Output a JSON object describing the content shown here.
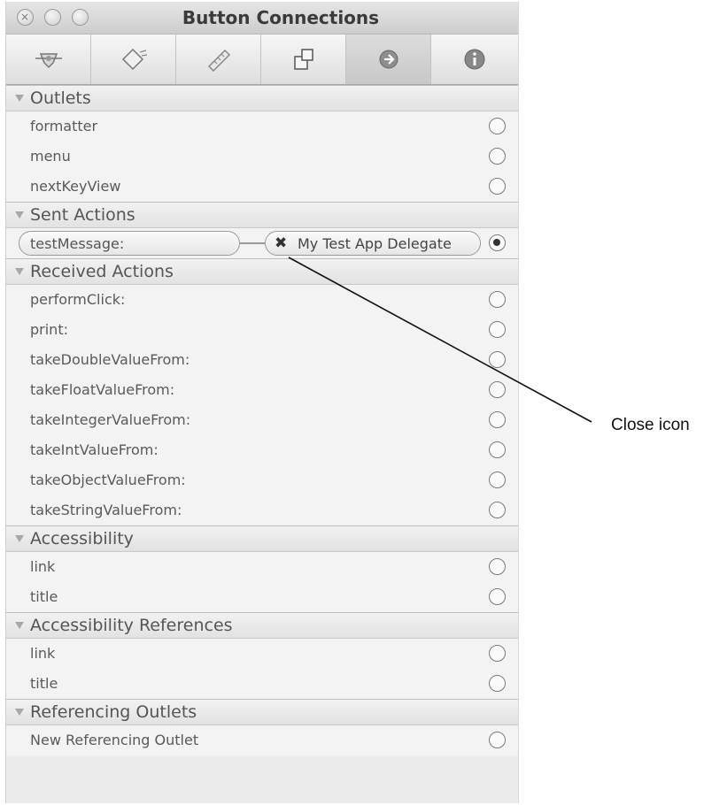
{
  "window": {
    "title": "Button Connections"
  },
  "toolbar": {
    "tabs": [
      {
        "icon": "attributes-icon"
      },
      {
        "icon": "effects-icon"
      },
      {
        "icon": "size-ruler-icon"
      },
      {
        "icon": "bindings-icon"
      },
      {
        "icon": "connections-icon",
        "selected": true
      },
      {
        "icon": "info-icon"
      }
    ]
  },
  "sections": {
    "outlets": {
      "title": "Outlets",
      "items": [
        "formatter",
        "menu",
        "nextKeyView"
      ]
    },
    "sent_actions": {
      "title": "Sent Actions",
      "action": "testMessage:",
      "target": "My Test App Delegate"
    },
    "received_actions": {
      "title": "Received Actions",
      "items": [
        "performClick:",
        "print:",
        "takeDoubleValueFrom:",
        "takeFloatValueFrom:",
        "takeIntegerValueFrom:",
        "takeIntValueFrom:",
        "takeObjectValueFrom:",
        "takeStringValueFrom:"
      ]
    },
    "accessibility": {
      "title": "Accessibility",
      "items": [
        "link",
        "title"
      ]
    },
    "accessibility_references": {
      "title": "Accessibility References",
      "items": [
        "link",
        "title"
      ]
    },
    "referencing_outlets": {
      "title": "Referencing Outlets",
      "items": [
        "New Referencing Outlet"
      ]
    }
  },
  "callout": {
    "label": "Close icon"
  }
}
